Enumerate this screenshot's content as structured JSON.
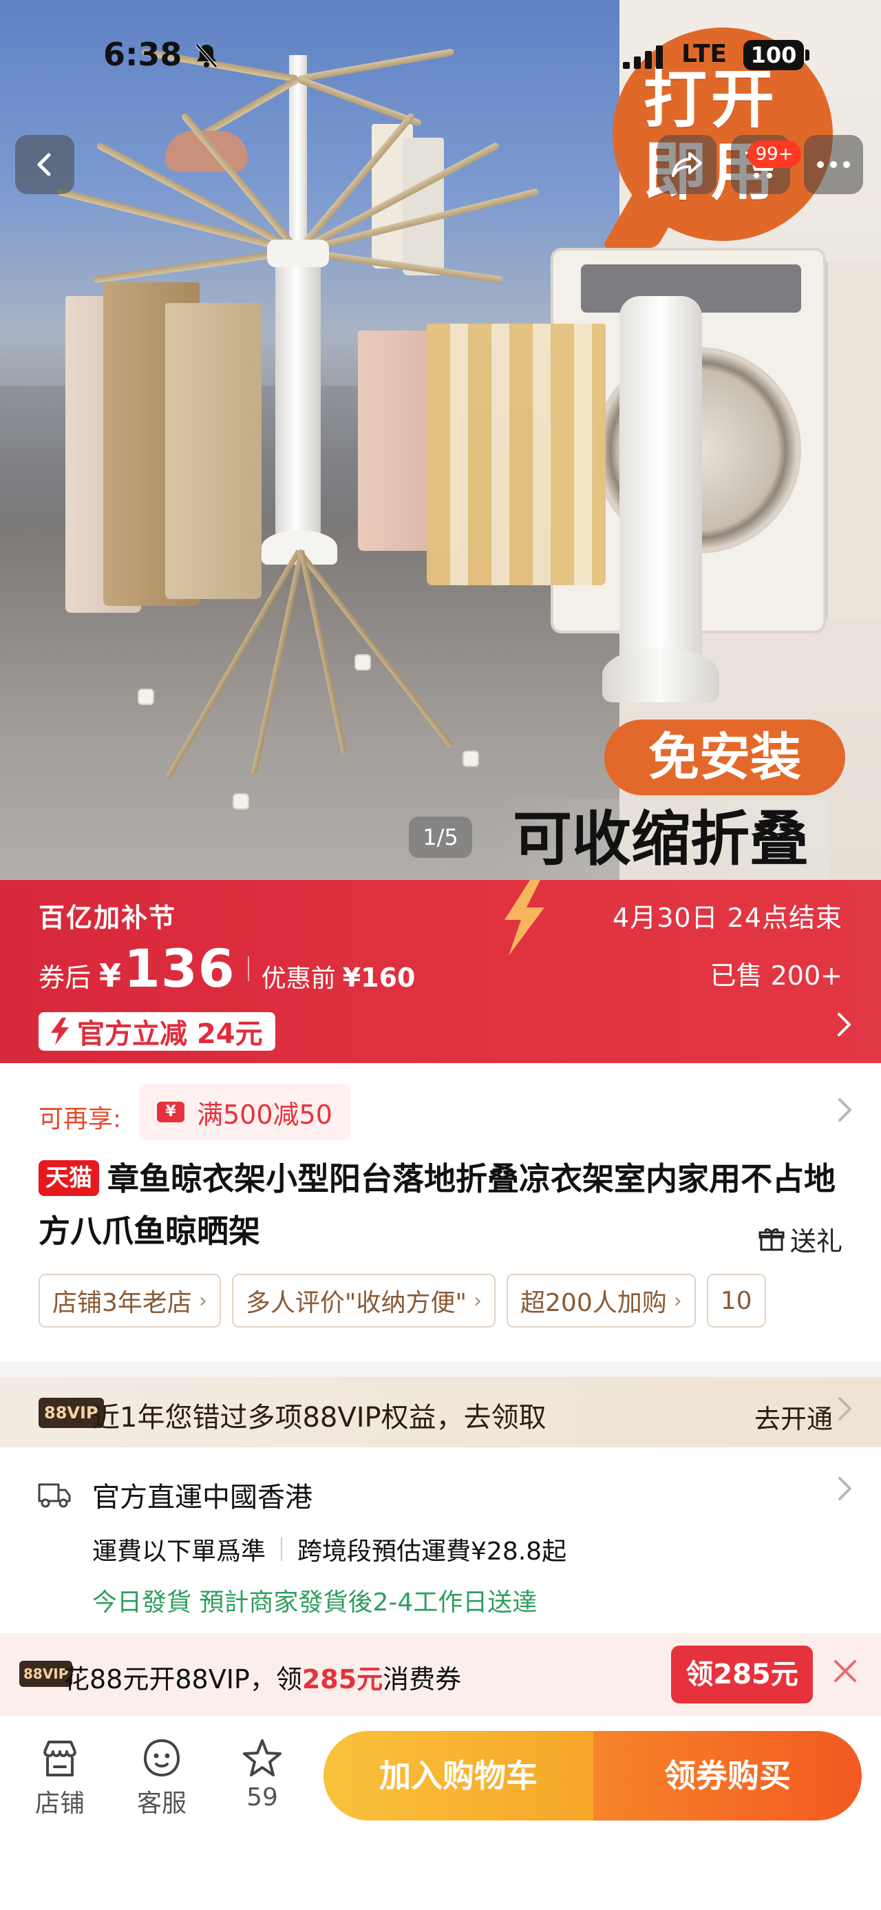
{
  "status_bar": {
    "time": "6:38",
    "network": "LTE",
    "battery": "100"
  },
  "nav": {
    "cart_badge": "99+"
  },
  "hero": {
    "badge_line1": "打开",
    "badge_line2": "即用",
    "promo_pill": "免安装",
    "promo_band": "可收缩折叠",
    "counter": "1/5"
  },
  "promo": {
    "festival": "百亿加补节",
    "deadline": "4月30日 24点结束",
    "price_label": "券后",
    "price_symbol": "¥",
    "price": "136",
    "orig_label": "优惠前",
    "orig_price": "¥160",
    "sold": "已售 200+",
    "coupon_tag": "官方立减 24元"
  },
  "product": {
    "extra_label": "可再享:",
    "extra_coupon": "满500减50",
    "store_badge": "天猫",
    "title": "章鱼晾衣架小型阳台落地折叠凉衣架室内家用不占地方八爪鱼晾晒架",
    "gift": "送礼",
    "tags": [
      "店铺3年老店",
      "多人评价\"收纳方便\"",
      "超200人加购",
      "10"
    ]
  },
  "vip_strip": {
    "badge": "88VIP",
    "text": "近1年您错过多项88VIP权益，去领取",
    "action": "去开通"
  },
  "shipping": {
    "title": "官方直運中國香港",
    "fee_note": "運費以下單爲準",
    "fee_estimate": "跨境段預估運費¥28.8起",
    "eta": "今日發貨  預計商家發貨後2-4工作日送達"
  },
  "vip_banner": {
    "badge": "88VIP",
    "text_pre": "花88元开88VIP，领",
    "text_hl": "285元",
    "text_post": "消费券",
    "claim": "领285元"
  },
  "tabbar": {
    "store": "店铺",
    "service": "客服",
    "fav_count": "59",
    "add_cart": "加入购物车",
    "buy": "领券购买"
  },
  "colors": {
    "promo_red": "#e0333f",
    "vip_red": "#e6323c",
    "cart_yellow": "#f6a628",
    "buy_orange": "#f25a21",
    "eta_green": "#2e9e5f"
  }
}
